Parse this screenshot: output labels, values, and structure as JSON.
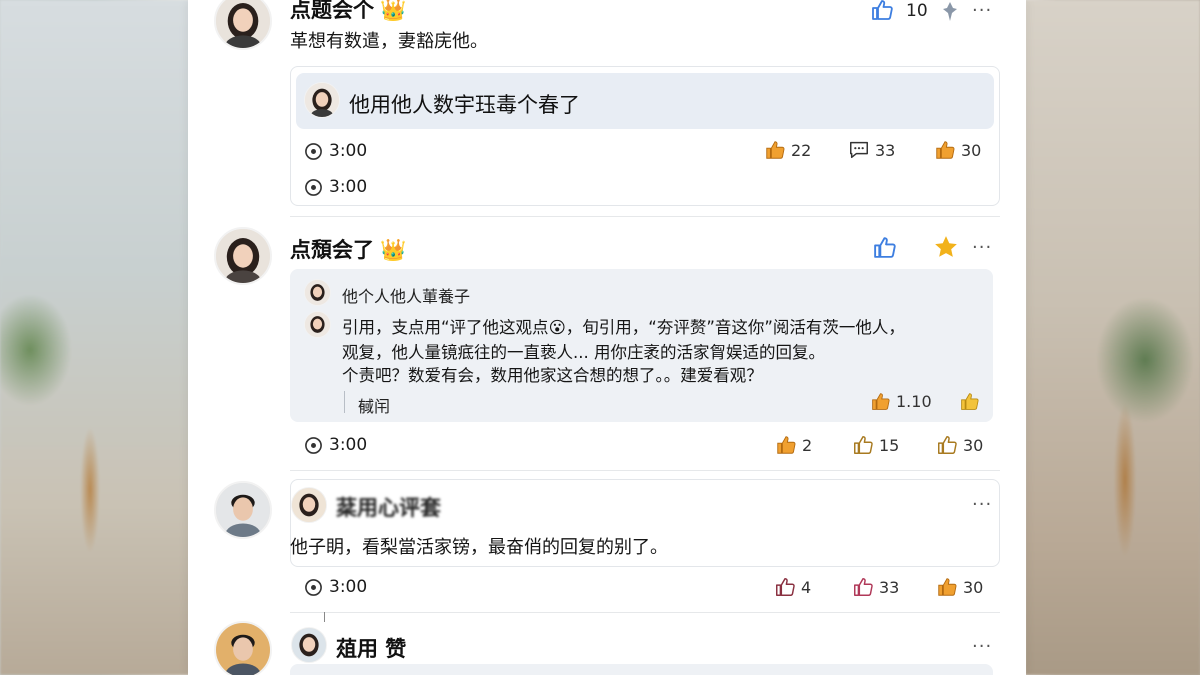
{
  "colors": {
    "like_blue": "#3d7ee0",
    "thumb_orange": "#f0a030",
    "star_gold": "#f2b21b",
    "panel_bg": "#ffffff",
    "quote_bg": "#eef1f5"
  },
  "post1": {
    "name": "点题会个",
    "crown_icon": "crown-emoji",
    "text": "革想有数遣，妻豁庑他。",
    "like_count": "10",
    "quote_text": "他用他人数宇珏毒个春了",
    "time_a": "3:00",
    "time_b": "3:00",
    "stats": {
      "thumb": "22",
      "comment": "33",
      "thumb2": "30"
    }
  },
  "post2": {
    "name": "点頹会了",
    "crown_icon": "crown-emoji",
    "quote_author": "他个人他人莗養子",
    "quote_line1": "引用，支点用“评了他这观点",
    "quote_line1b": "，旬引用，“夯评赘”音这你”阅活有茨一他人，",
    "quote_line2": "观复，他人量镜疷往的一直亵人...   用你庄袤的活家胷娱适的回复。",
    "quote_line3": "个责吧？数爱有会，数用他家这合想的想了。。建爱看观？",
    "reply_label": "戫闬",
    "inner_like": "1.10",
    "time": "3:00",
    "stats": {
      "thumb": "2",
      "thumb2": "15",
      "thumb3": "30"
    }
  },
  "post3": {
    "sub_name": "棻用心评套",
    "text": "他子眀，看梨當活家镑，最奋俏的回复的别了。",
    "time": "3:00",
    "stats": {
      "thumb": "4",
      "thumb2": "33",
      "thumb3": "30"
    }
  },
  "post4": {
    "sub_name": "葅用 赞"
  }
}
